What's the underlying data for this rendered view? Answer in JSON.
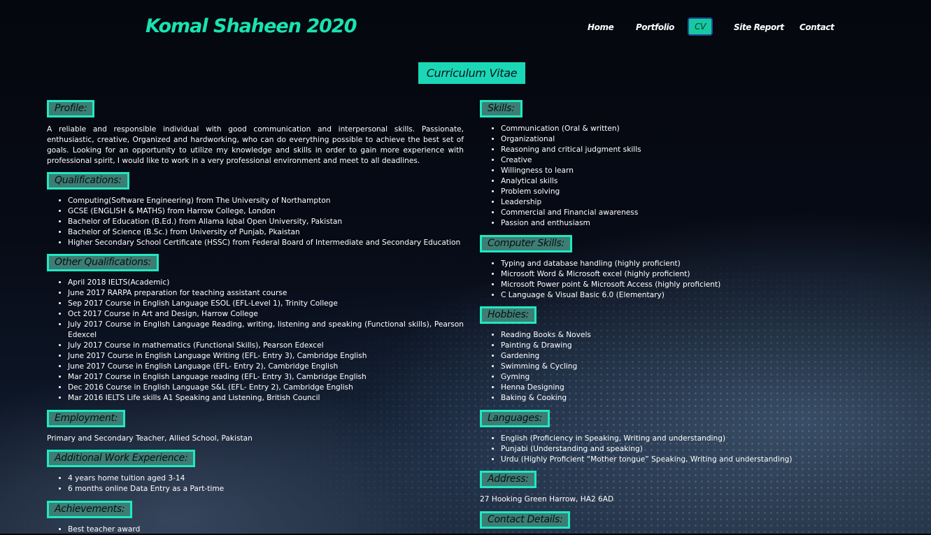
{
  "site": {
    "brand": "Komal Shaheen 2020"
  },
  "nav": {
    "items": [
      "Home",
      "Portfolio",
      "CV",
      "Site Report",
      "Contact"
    ],
    "active": "CV"
  },
  "page_title": "Curriculum Vitae",
  "profile": {
    "heading": "Profile:",
    "text": "A reliable and responsible individual with good communication and interpersonal skills. Passionate, enthusiastic, creative, Organized and hardworking, who can do everything possible to achieve the best set of goals. Looking for an opportunity to utilize my knowledge and skills in order to gain more experience with professional spirit, I would like to work in a very professional environment and meet to all deadlines."
  },
  "qualifications": {
    "heading": "Qualifications:",
    "items": [
      "Computing(Software Engineering) from The University of Northampton",
      "GCSE (ENGLISH & MATHS) from Harrow College, London",
      "Bachelor of Education (B.Ed.) from Allama Iqbal Open University, Pakistan",
      "Bachelor of Science (B.Sc.) from University of Punjab, Pkaistan",
      "Higher Secondary School Certificate (HSSC) from Federal Board of Intermediate and Secondary Education"
    ]
  },
  "other_qualifications": {
    "heading": "Other Qualifications:",
    "items": [
      "April 2018 IELTS(Academic)",
      "June 2017 RARPA preparation for teaching assistant course",
      "Sep 2017 Course in English Language ESOL (EFL-Level 1), Trinity College",
      "Oct 2017 Course in Art and Design, Harrow College",
      "July 2017 Course in English Language Reading, writing, listening and speaking (Functional skills), Pearson Edexcel",
      "July 2017 Course in mathematics (Functional Skills), Pearson Edexcel",
      "June 2017 Course in English Language Writing (EFL- Entry 3), Cambridge English",
      "June 2017 Course in English Language (EFL- Entry 2), Cambridge English",
      "Mar 2017 Course in English Language reading (EFL- Entry 3), Cambridge English",
      "Dec 2016 Course in English Language S&L (EFL- Entry 2), Cambridge English",
      "Mar 2016 IELTS Life skills A1 Speaking and Listening, British Council"
    ]
  },
  "employment": {
    "heading": "Employment:",
    "text": "Primary and Secondary Teacher, Allied School, Pakistan"
  },
  "additional_work": {
    "heading": "Additional Work Experience:",
    "items": [
      "4 years home tuition aged 3-14",
      "6 months online Data Entry as a Part-time"
    ]
  },
  "achievements": {
    "heading": "Achievements:",
    "items": [
      "Best teacher award"
    ]
  },
  "skills": {
    "heading": "Skills:",
    "items": [
      "Communication (Oral & written)",
      "Organizational",
      "Reasoning and critical judgment skills",
      "Creative",
      "Willingness to learn",
      "Analytical skills",
      "Problem solving",
      "Leadership",
      "Commercial and Financial awareness",
      "Passion and enthusiasm"
    ]
  },
  "computer_skills": {
    "heading": "Computer Skills:",
    "items": [
      "Typing and database handling (highly proficient)",
      "Microsoft Word & Microsoft excel (highly proficient)",
      "Microsoft Power point & Microsoft Access (highly proficient)",
      "C Language & Visual Basic 6.0 (Elementary)"
    ]
  },
  "hobbies": {
    "heading": "Hobbies:",
    "items": [
      "Reading Books & Novels",
      "Painting & Drawing",
      "Gardening",
      "Swimming & Cycling",
      "Gyming",
      "Henna Designing",
      "Baking & Cooking"
    ]
  },
  "languages": {
    "heading": "Languages:",
    "items": [
      "English (Proficiency in Speaking, Writing and understanding)",
      "Punjabi (Understanding and speaking)",
      "Urdu (Highly Proficient “Mother tongue” Speaking, Writing and understanding)"
    ]
  },
  "address": {
    "heading": "Address:",
    "text": "27 Hooking Green Harrow, HA2 6AD"
  },
  "contact_details": {
    "heading": "Contact Details:"
  },
  "colors": {
    "accent": "#1ee8c2",
    "heading_bg": "#3d7d73",
    "brand": "#19e3b1",
    "active_nav_border": "#1f4ea0"
  }
}
